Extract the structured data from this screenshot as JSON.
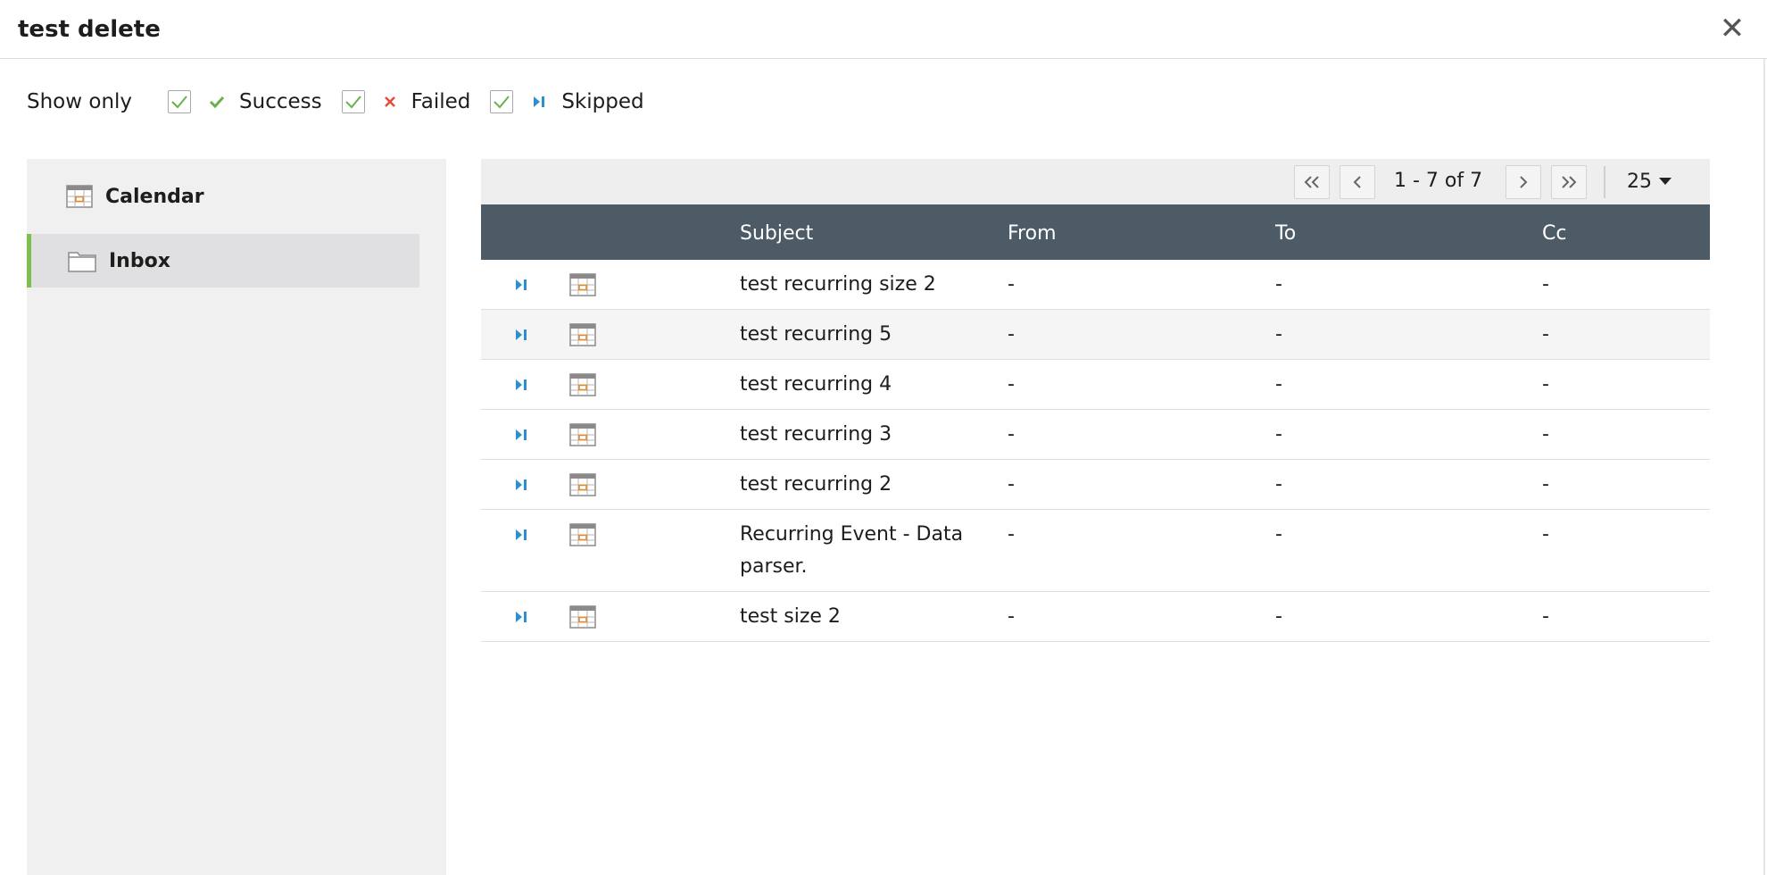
{
  "dialog": {
    "title": "test delete"
  },
  "filters": {
    "label": "Show only",
    "items": [
      {
        "label": "Success",
        "checked": true,
        "icon": "check-icon",
        "color": "#6ab04c"
      },
      {
        "label": "Failed",
        "checked": true,
        "icon": "cross-icon",
        "color": "#e74c3c"
      },
      {
        "label": "Skipped",
        "checked": true,
        "icon": "skip-icon",
        "color": "#2e8fd0"
      }
    ]
  },
  "sidebar": {
    "items": [
      {
        "label": "Calendar",
        "icon": "calendar-icon",
        "active": false
      },
      {
        "label": "Inbox",
        "icon": "folder-icon",
        "active": true
      }
    ]
  },
  "pagination": {
    "info": "1 - 7 of 7",
    "page_size": "25"
  },
  "table": {
    "columns": {
      "subject": "Subject",
      "from": "From",
      "to": "To",
      "cc": "Cc"
    },
    "rows": [
      {
        "status": "skipped",
        "type": "calendar",
        "subject": "test recurring size 2",
        "from": "-",
        "to": "-",
        "cc": "-"
      },
      {
        "status": "skipped",
        "type": "calendar",
        "subject": "test recurring 5",
        "from": "-",
        "to": "-",
        "cc": "-"
      },
      {
        "status": "skipped",
        "type": "calendar",
        "subject": "test recurring 4",
        "from": "-",
        "to": "-",
        "cc": "-"
      },
      {
        "status": "skipped",
        "type": "calendar",
        "subject": "test recurring 3",
        "from": "-",
        "to": "-",
        "cc": "-"
      },
      {
        "status": "skipped",
        "type": "calendar",
        "subject": "test recurring 2",
        "from": "-",
        "to": "-",
        "cc": "-"
      },
      {
        "status": "skipped",
        "type": "calendar",
        "subject": "Recurring Event - Data parser.",
        "from": "-",
        "to": "-",
        "cc": "-"
      },
      {
        "status": "skipped",
        "type": "calendar",
        "subject": "test size 2",
        "from": "-",
        "to": "-",
        "cc": "-"
      }
    ]
  },
  "colors": {
    "accent": "#7cbf4a",
    "header_bg": "#4d5b66",
    "skip": "#2e8fd0"
  }
}
